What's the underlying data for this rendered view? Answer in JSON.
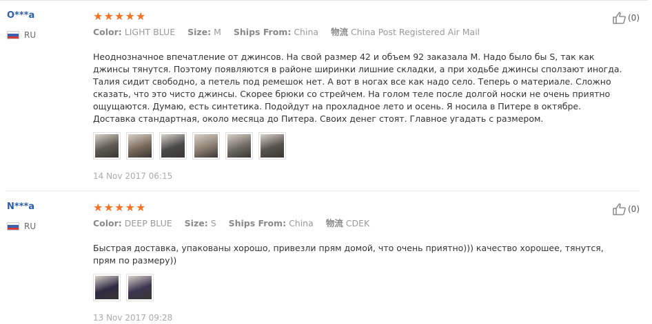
{
  "reviews": [
    {
      "user": "O***a",
      "country": "RU",
      "rating": 5,
      "color_label": "Color:",
      "color": "LIGHT BLUE",
      "size_label": "Size:",
      "size": "M",
      "ships_label": "Ships From:",
      "ships_from": "China",
      "logistics_label": "物流",
      "logistics": "China Post Registered Air Mail",
      "text": "Неоднозначное впечатление от джинсов. На свой размер 42 и объем 92 заказала М. Надо было бы S, так как джинсы тянутся. Поэтому появляются в районе ширинки лишние складки, а при ходьбе джинсы сползают иногда. Талия сидит свободно, а петель под ремешок нет. А вот в ногах все как надо село. Теперь о материале. Сложно сказать, что это чисто джинсы. Скорее брюки со стрейчем. На голом теле после долгой носки не очень приятно ощущаются. Думаю, есть синтетика. Подойдут на прохладное лето и осень. Я носила в Питере в октябре. Доставка стандартная, около месяца до Питера. Своих денег стоят. Главное угадать с размером.",
      "photos": [
        "#5d5a52",
        "#7a6a5c",
        "#4a4a4a",
        "#8c7f72",
        "#6f6b65",
        "#56524e"
      ],
      "date": "14 Nov 2017 06:15",
      "helpful_count": "(0)"
    },
    {
      "user": "N***a",
      "country": "RU",
      "rating": 5,
      "color_label": "Color:",
      "color": "DEEP BLUE",
      "size_label": "Size:",
      "size": "S",
      "ships_label": "Ships From:",
      "ships_from": "China",
      "logistics_label": "物流",
      "logistics": "CDEK",
      "text": "Быстрая доставка, упакованы хорошо, привезли прям домой, что очень приятно))) качество хорошее, тянутся, прям по размеру))",
      "photos": [
        "#2f2a44",
        "#3c3552"
      ],
      "date": "13 Nov 2017 09:28",
      "helpful_count": "(0)"
    }
  ],
  "colors": {
    "star": "#f57224",
    "username": "#2b5ea8"
  },
  "icons": {
    "thumb": "thumbs-up-icon",
    "star": "star-icon",
    "flag": "ru-flag-icon"
  }
}
